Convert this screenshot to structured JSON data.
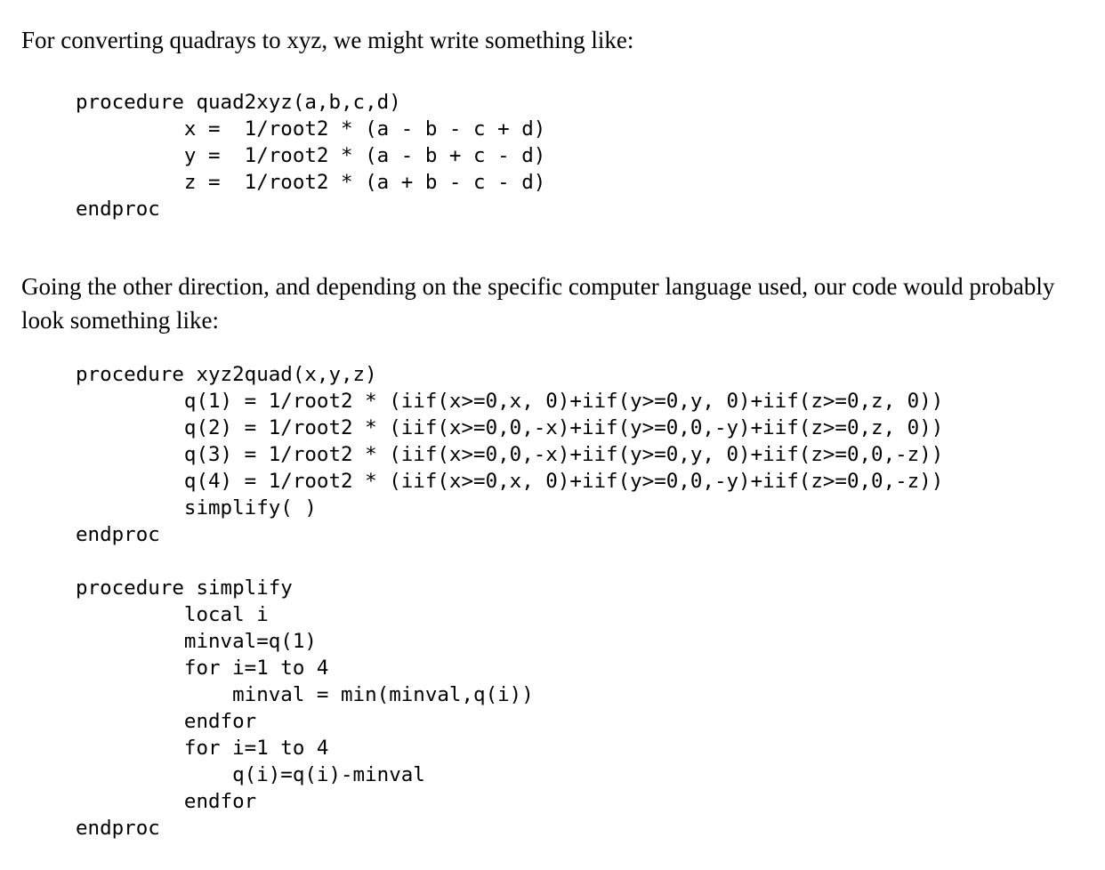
{
  "document": {
    "paragraphs": {
      "intro": "For converting quadrays to xyz, we might write something like:",
      "second": "Going the other direction, and depending on the specific computer language used, our code would probably look something like:"
    },
    "code_blocks": [
      {
        "name": "quad2xyz",
        "lines": [
          "procedure quad2xyz(a,b,c,d)",
          "         x =  1/root2 * (a - b - c + d)",
          "         y =  1/root2 * (a - b + c - d)",
          "         z =  1/root2 * (a + b - c - d)",
          "endproc"
        ]
      },
      {
        "name": "xyz2quad-and-simplify",
        "lines": [
          "procedure xyz2quad(x,y,z)",
          "         q(1) = 1/root2 * (iif(x>=0,x, 0)+iif(y>=0,y, 0)+iif(z>=0,z, 0))",
          "         q(2) = 1/root2 * (iif(x>=0,0,-x)+iif(y>=0,0,-y)+iif(z>=0,z, 0))",
          "         q(3) = 1/root2 * (iif(x>=0,0,-x)+iif(y>=0,y, 0)+iif(z>=0,0,-z))",
          "         q(4) = 1/root2 * (iif(x>=0,x, 0)+iif(y>=0,0,-y)+iif(z>=0,0,-z))",
          "         simplify( )",
          "endproc",
          "",
          "procedure simplify",
          "         local i",
          "         minval=q(1)",
          "         for i=1 to 4",
          "             minval = min(minval,q(i))",
          "         endfor",
          "         for i=1 to 4",
          "             q(i)=q(i)-minval",
          "         endfor",
          "endproc"
        ]
      }
    ]
  }
}
